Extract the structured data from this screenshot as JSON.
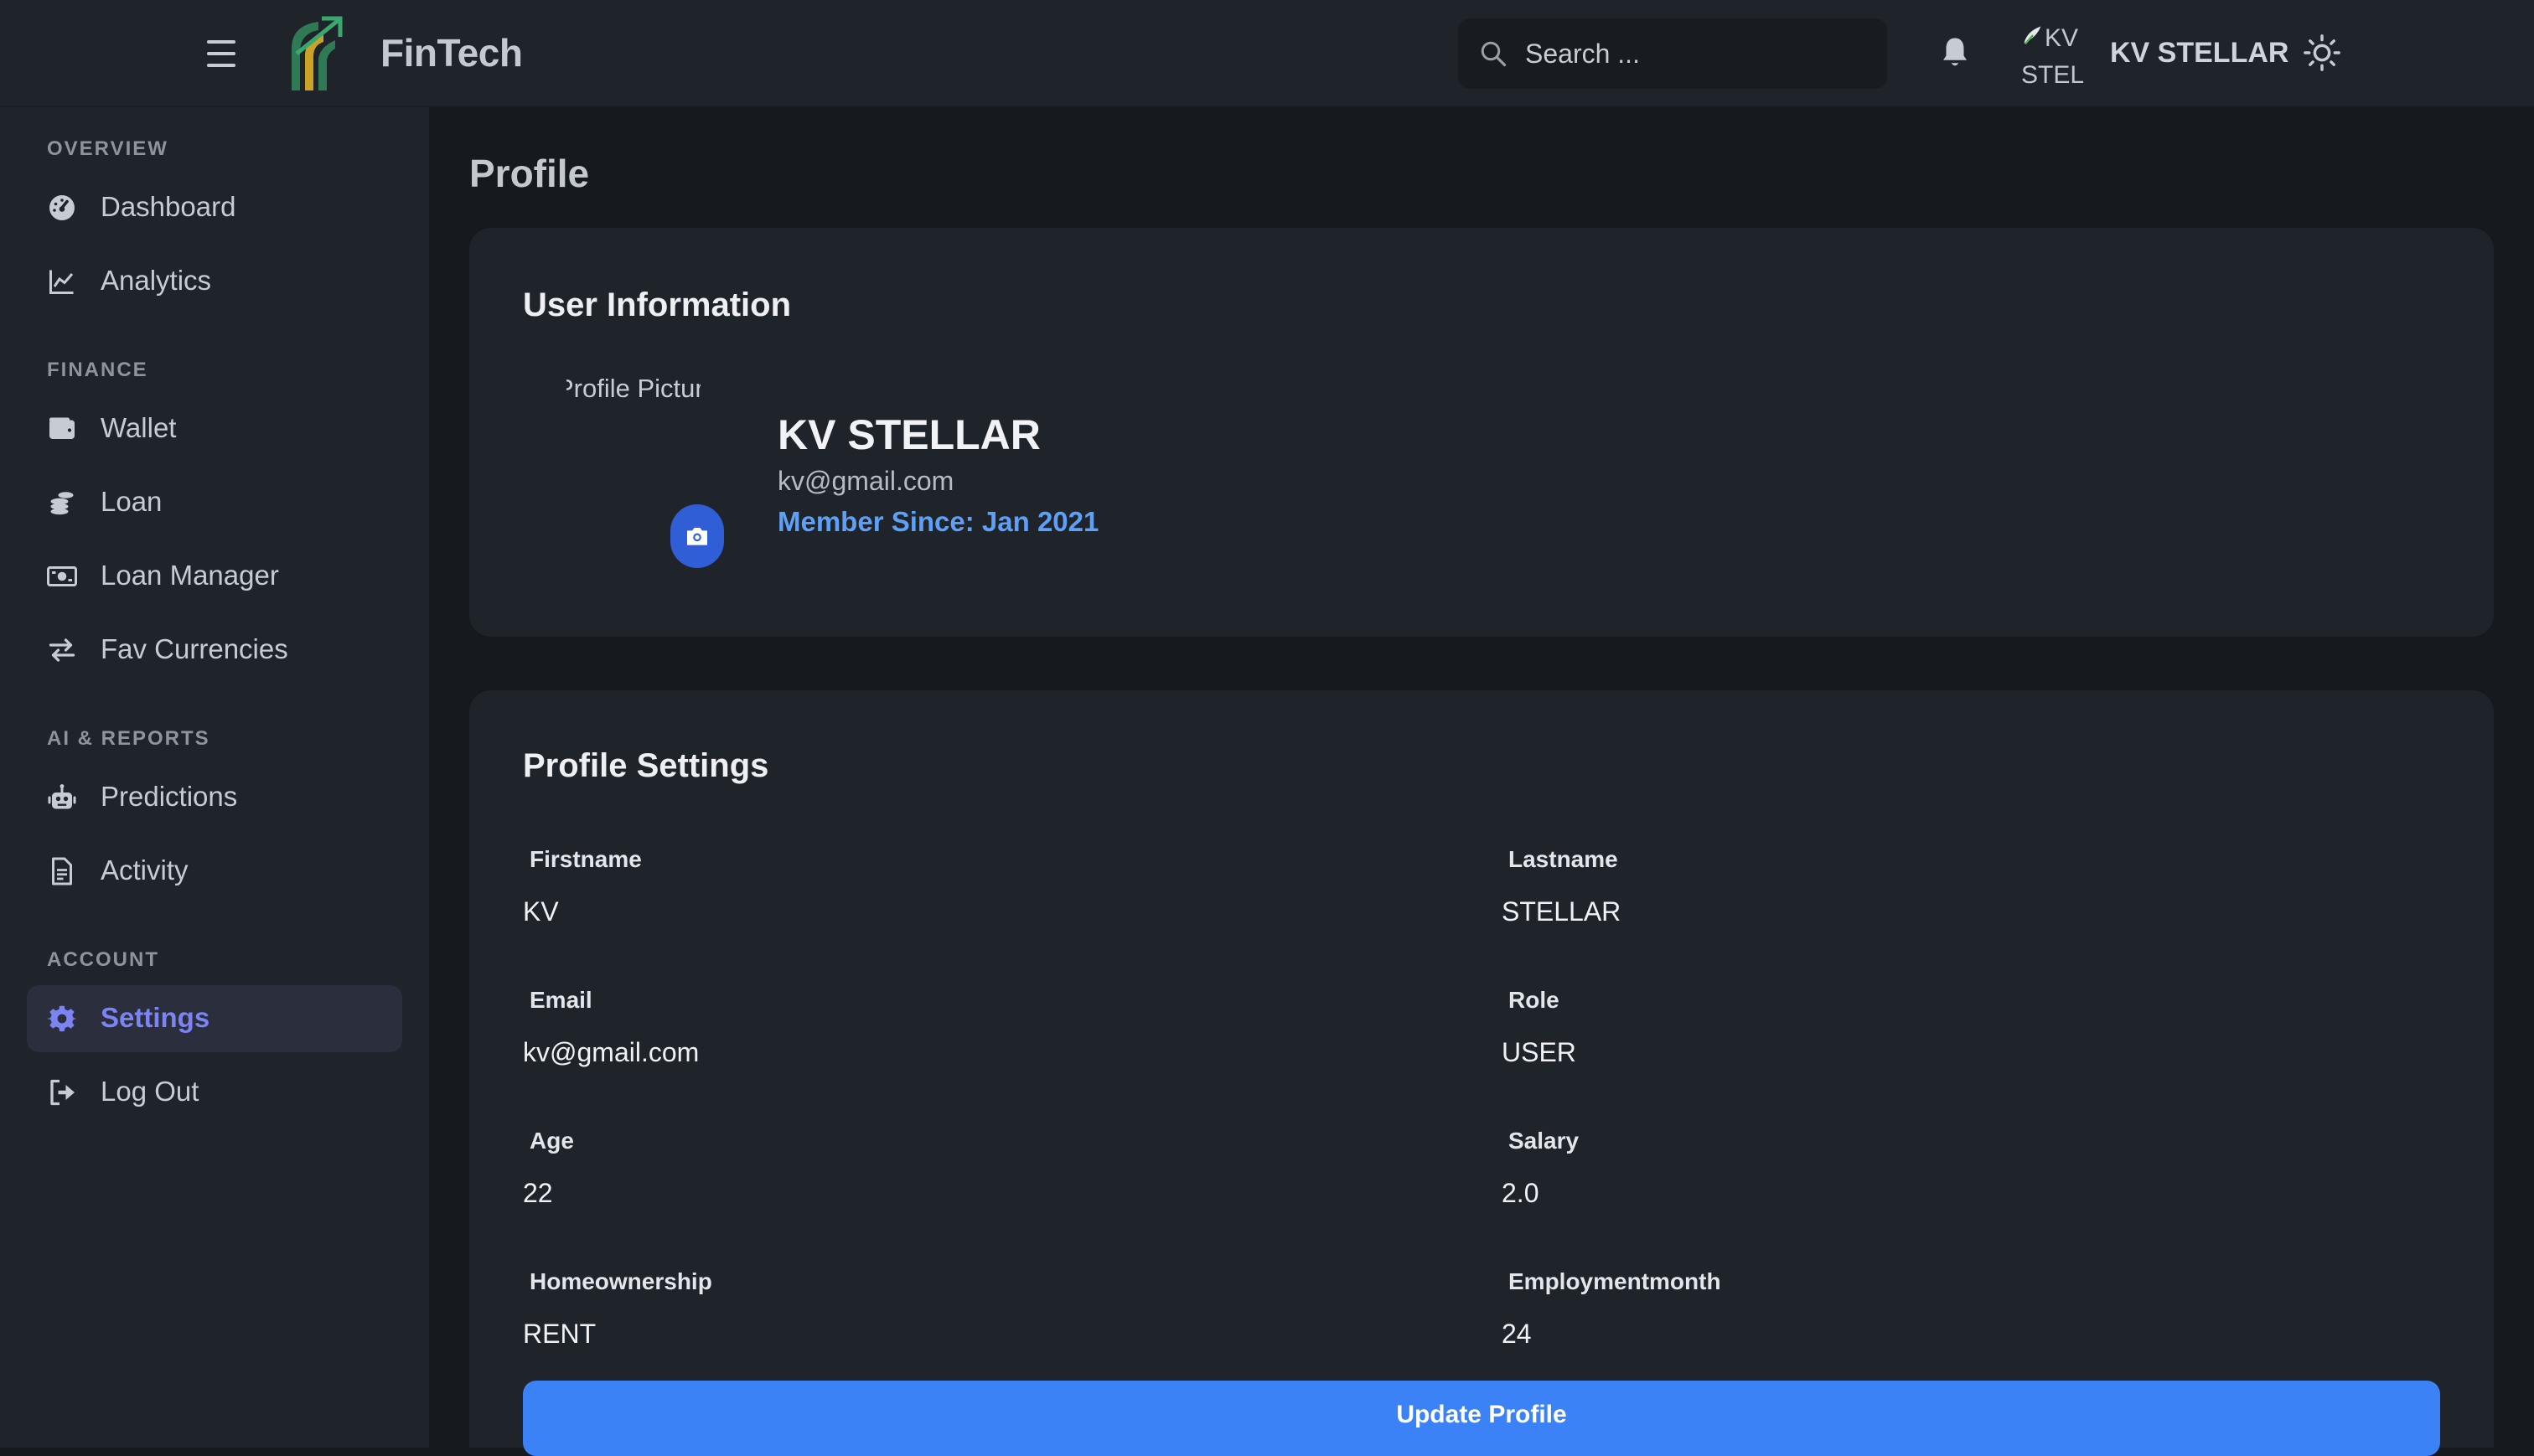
{
  "app": {
    "name": "FinTech",
    "brand_color": "#3b82f6"
  },
  "header": {
    "search_placeholder": "Search ...",
    "avatar_alt": "KV STEL",
    "username": "KV STELLAR",
    "icons": [
      "hamburger-icon",
      "search-icon",
      "bell-icon",
      "sun-icon"
    ]
  },
  "sidebar": {
    "sections": [
      {
        "title": "OVERVIEW",
        "items": [
          {
            "label": "Dashboard",
            "icon": "dashboard-icon"
          },
          {
            "label": "Analytics",
            "icon": "chart-line-icon"
          }
        ]
      },
      {
        "title": "FINANCE",
        "items": [
          {
            "label": "Wallet",
            "icon": "wallet-icon"
          },
          {
            "label": "Loan",
            "icon": "coins-icon"
          },
          {
            "label": "Loan Manager",
            "icon": "money-bill-icon"
          },
          {
            "label": "Fav Currencies",
            "icon": "exchange-icon"
          }
        ]
      },
      {
        "title": "AI & REPORTS",
        "items": [
          {
            "label": "Predictions",
            "icon": "robot-icon"
          },
          {
            "label": "Activity",
            "icon": "file-icon"
          }
        ]
      },
      {
        "title": "ACCOUNT",
        "items": [
          {
            "label": "Settings",
            "icon": "gear-icon",
            "active": true
          },
          {
            "label": "Log Out",
            "icon": "logout-icon"
          }
        ]
      }
    ],
    "active_color": "#7c83f2"
  },
  "main": {
    "page_title": "Profile",
    "user_info": {
      "title": "User Information",
      "profile_picture_alt": "Profile Picture",
      "full_name": "KV STELLAR",
      "email": "kv@gmail.com",
      "member_since": "Member Since: Jan 2021"
    },
    "settings": {
      "title": "Profile Settings",
      "fields": [
        {
          "label": "Firstname",
          "value": "KV"
        },
        {
          "label": "Lastname",
          "value": "STELLAR"
        },
        {
          "label": "Email",
          "value": "kv@gmail.com"
        },
        {
          "label": "Role",
          "value": "USER"
        },
        {
          "label": "Age",
          "value": "22"
        },
        {
          "label": "Salary",
          "value": "2.0"
        },
        {
          "label": "Homeownership",
          "value": "RENT"
        },
        {
          "label": "Employmentmonth",
          "value": "24"
        }
      ],
      "submit_label": "Update Profile"
    }
  }
}
